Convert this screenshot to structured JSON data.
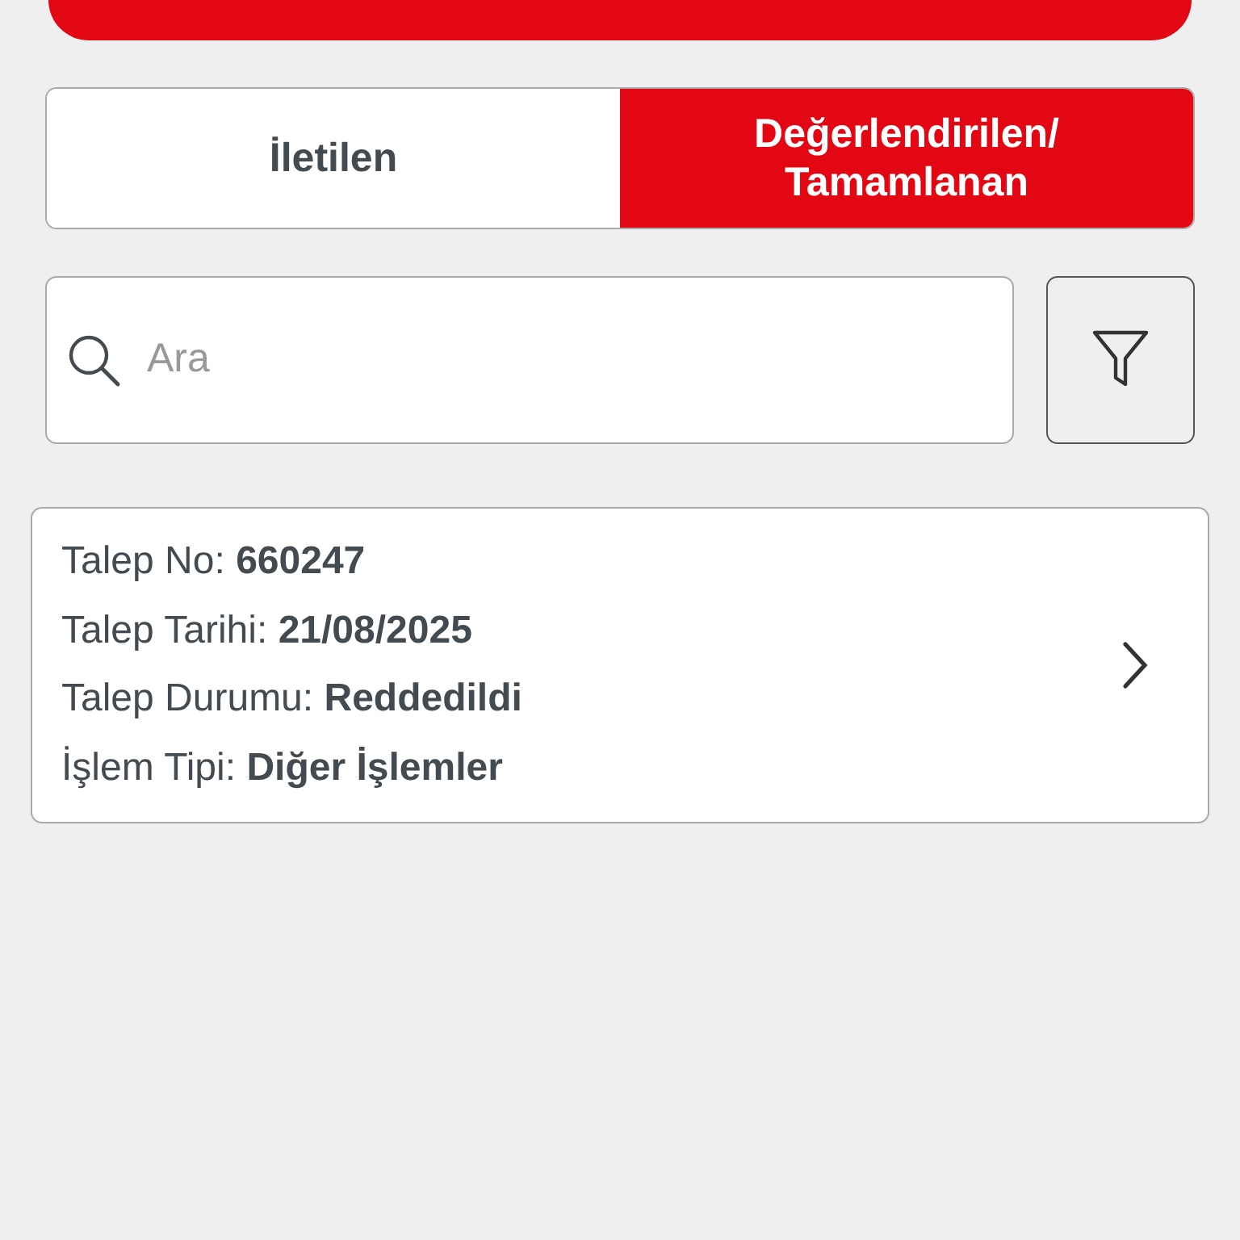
{
  "segments": [
    {
      "label": "İletilen",
      "selected": false
    },
    {
      "label": "Değerlendirilen/ Tamamlanan",
      "selected": true
    }
  ],
  "search": {
    "placeholder": "Ara"
  },
  "requests": [
    {
      "fields": [
        {
          "label": "Talep No:",
          "value": "660247"
        },
        {
          "label": "Talep Tarihi:",
          "value": "21/08/2025"
        },
        {
          "label": "Talep Durumu:",
          "value": "Reddedildi"
        },
        {
          "label": "İşlem Tipi:",
          "value": "Diğer İşlemler"
        }
      ]
    }
  ]
}
